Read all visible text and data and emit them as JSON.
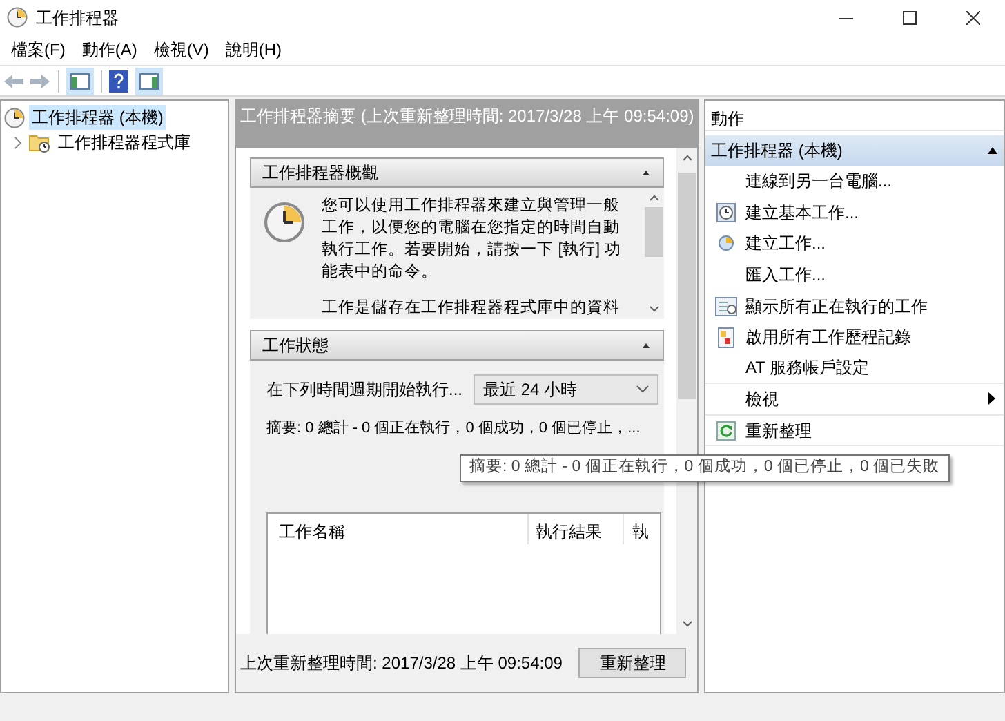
{
  "window": {
    "title": "工作排程器"
  },
  "menu": [
    "檔案(F)",
    "動作(A)",
    "檢視(V)",
    "說明(H)"
  ],
  "tree": [
    {
      "label": "工作排程器 (本機)",
      "selected": true,
      "children": [
        {
          "label": "工作排程器程式庫",
          "selected": false,
          "expanded": false
        }
      ]
    }
  ],
  "summary": {
    "header": "工作排程器摘要 (上次重新整理時間: 2017/3/28 上午 09:54:09)",
    "overview": {
      "title": "工作排程器概觀",
      "expanded": true,
      "paragraphs": [
        "您可以使用工作排程器來建立與管理一般工作，以便您的電腦在您指定的時間自動執行工作。若要開始，請按一下 [執行] 功能表中的命令。",
        "工作是儲存在工作排程器程式庫中的資料"
      ]
    },
    "status": {
      "title": "工作狀態",
      "expanded": true,
      "period_label": "在下列時間週期開始執行...",
      "period_select": {
        "value": "最近 24 小時"
      },
      "summary_text": "摘要: 0 總計 - 0 個正在執行，0 個成功，0 個已停止，...",
      "tooltip": "摘要: 0 總計 - 0 個正在執行，0 個成功，0 個已停止，0 個已失敗",
      "columns": [
        "工作名稱",
        "執行結果",
        "執"
      ]
    },
    "last_refresh": "上次重新整理時間: 2017/3/28 上午 09:54:09",
    "refresh_button": "重新整理"
  },
  "actions": {
    "title": "動作",
    "group": {
      "title": "工作排程器 (本機)",
      "expanded": true
    },
    "items": [
      {
        "label": "連線到另一台電腦...",
        "kind": "plain"
      },
      {
        "label": "建立基本工作...",
        "kind": "basic-task"
      },
      {
        "label": "建立工作...",
        "kind": "task"
      },
      {
        "label": "匯入工作...",
        "kind": "plain"
      },
      {
        "label": "顯示所有正在執行的工作",
        "kind": "running"
      },
      {
        "label": "啟用所有工作歷程記錄",
        "kind": "history"
      },
      {
        "label": "AT 服務帳戶設定",
        "kind": "plain"
      },
      {
        "label": "檢視",
        "kind": "submenu"
      },
      {
        "label": "重新整理",
        "kind": "refresh"
      }
    ]
  }
}
